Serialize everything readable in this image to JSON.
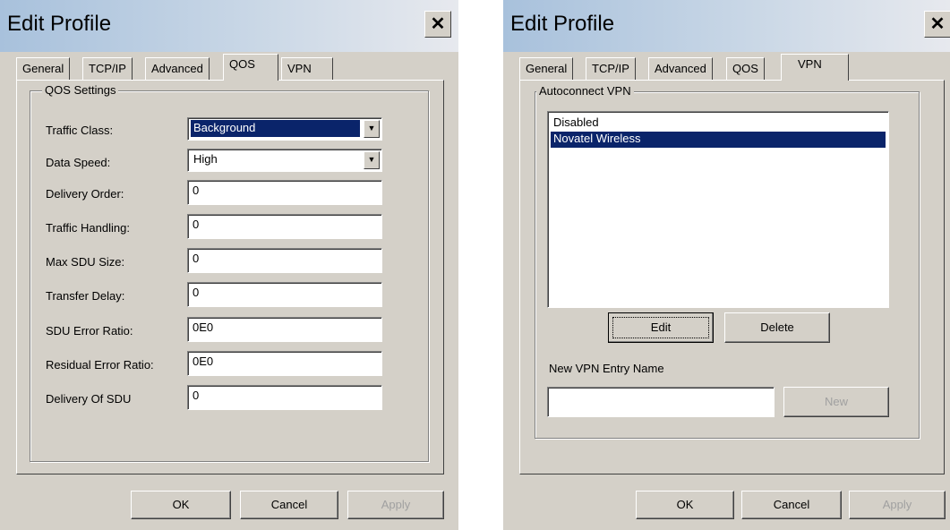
{
  "qos_dialog": {
    "title": "Edit Profile",
    "close_glyph": "✕",
    "tabs": [
      "General",
      "TCP/IP",
      "Advanced",
      "QOS",
      "VPN"
    ],
    "active_tab": "QOS",
    "group_label": "QOS Settings",
    "fields": [
      {
        "label": "Traffic Class:",
        "value": "Background",
        "type": "select",
        "highlighted": true
      },
      {
        "label": "Data Speed:",
        "value": "High",
        "type": "select",
        "highlighted": false
      },
      {
        "label": "Delivery Order:",
        "value": "0",
        "type": "text"
      },
      {
        "label": "Traffic Handling:",
        "value": "0",
        "type": "text"
      },
      {
        "label": "Max SDU Size:",
        "value": "0",
        "type": "text"
      },
      {
        "label": "Transfer Delay:",
        "value": "0",
        "type": "text"
      },
      {
        "label": "SDU Error Ratio:",
        "value": "0E0",
        "type": "text"
      },
      {
        "label": "Residual Error Ratio:",
        "value": "0E0",
        "type": "text"
      },
      {
        "label": "Delivery Of SDU",
        "value": "0",
        "type": "text"
      }
    ],
    "buttons": {
      "ok": "OK",
      "cancel": "Cancel",
      "apply": "Apply"
    }
  },
  "vpn_dialog": {
    "title": "Edit Profile",
    "close_glyph": "✕",
    "tabs": [
      "General",
      "TCP/IP",
      "Advanced",
      "QOS",
      "VPN"
    ],
    "active_tab": "VPN",
    "group_label": "Autoconnect VPN",
    "list_items": [
      {
        "label": "Disabled",
        "selected": false
      },
      {
        "label": "Novatel Wireless",
        "selected": true
      }
    ],
    "edit_button": "Edit",
    "delete_button": "Delete",
    "new_entry_label": "New VPN Entry Name",
    "new_entry_value": "",
    "new_button": "New",
    "buttons": {
      "ok": "OK",
      "cancel": "Cancel",
      "apply": "Apply"
    }
  },
  "colors": {
    "selection": "#0a246a",
    "face": "#d4d0c8",
    "disabled_text": "#a0a0a0"
  }
}
